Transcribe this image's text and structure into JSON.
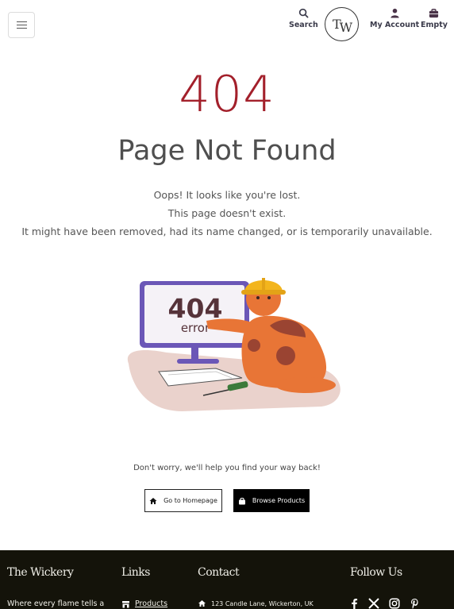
{
  "header": {
    "menu_icon": "hamburger-icon",
    "search_label": "Search",
    "logo_text_a": "T",
    "logo_text_b": "W",
    "account_label": "My Account",
    "cart_label": "Empty"
  },
  "error": {
    "code": "404",
    "title": "Page Not Found",
    "line1": "Oops! It looks like you're lost.",
    "line2": "This page doesn't exist.",
    "line3": "It might have been removed, had its name changed, or is temporarily unavailable.",
    "illustration": {
      "screen_code": "404",
      "screen_word": "error"
    },
    "reassure": "Don't worry, we'll help you find your way back!",
    "home_button": "Go to Homepage",
    "browse_button": "Browse Products"
  },
  "footer": {
    "brand_title": "The Wickery",
    "brand_text": "Where every flame tells a",
    "links_title": "Links",
    "links_item": "Products",
    "contact_title": "Contact",
    "contact_address": "123 Candle Lane, Wickerton, UK",
    "follow_title": "Follow Us",
    "social_icons": [
      "facebook-icon",
      "x-icon",
      "instagram-icon",
      "pinterest-icon"
    ]
  },
  "colors": {
    "accent": "#a3202b",
    "footer_bg": "#14130a"
  }
}
